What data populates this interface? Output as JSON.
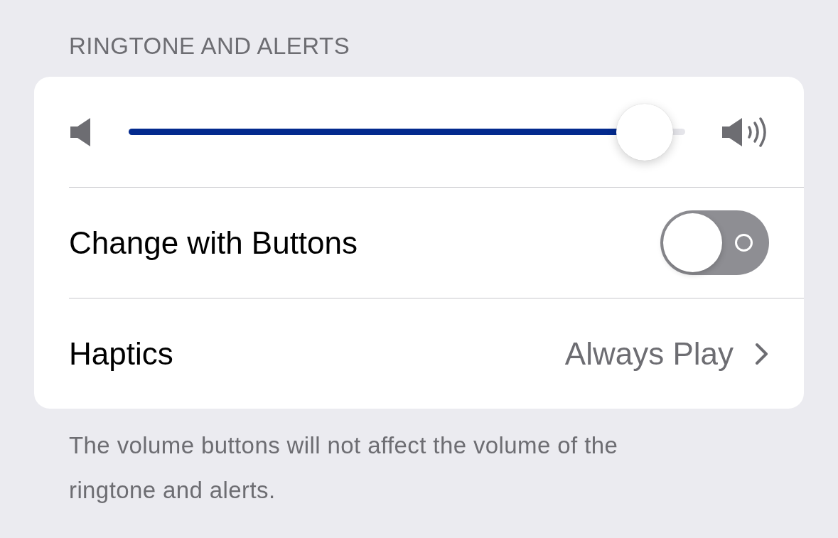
{
  "section": {
    "header": "RINGTONE AND ALERTS",
    "volume": {
      "level": 0.95
    },
    "rows": [
      {
        "kind": "toggle",
        "label": "Change with Buttons",
        "on": false
      },
      {
        "kind": "link",
        "label": "Haptics",
        "value": "Always Play"
      }
    ],
    "footer": "The volume buttons will not affect the volume of the ringtone and alerts."
  }
}
